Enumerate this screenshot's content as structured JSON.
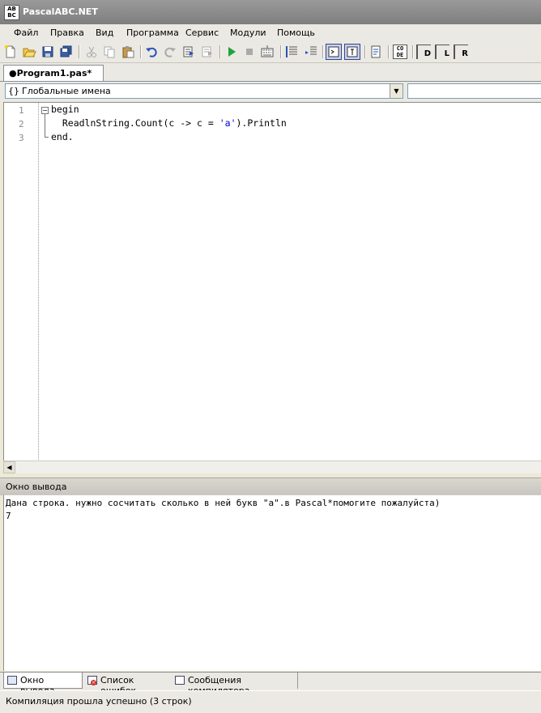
{
  "window": {
    "title": "PascalABC.NET",
    "icon_text": "AB\nBC"
  },
  "menu": [
    "Файл",
    "Правка",
    "Вид",
    "Программа",
    "Сервис",
    "Модули",
    "Помощь"
  ],
  "toolbar": {
    "icons": [
      "new-file-icon",
      "open-file-icon",
      "save-icon",
      "save-all-icon",
      "cut-icon",
      "copy-icon",
      "paste-icon",
      "undo-icon",
      "redo-icon",
      "step-into-icon",
      "step-over-icon",
      "run-icon",
      "stop-icon",
      "compile-icon",
      "comment-icon",
      "uncomment-icon",
      "console-view-icon",
      "text-view-icon",
      "format-icon",
      "code-icon",
      "sort-d-icon",
      "sort-l-icon",
      "sort-r-icon"
    ],
    "code_label": "CO\nDE",
    "d_label": "D",
    "l_label": "L",
    "r_label": "R"
  },
  "tabs": [
    {
      "label": "●Program1.pas*",
      "active": true
    }
  ],
  "scope": {
    "icon": "{}",
    "label": "Глобальные имена"
  },
  "editor": {
    "line_numbers": [
      "1",
      "2",
      "3"
    ],
    "lines": [
      {
        "text": "begin"
      },
      {
        "prefix": "  ReadlnString.Count(c -> c = ",
        "string": "'a'",
        "suffix": ").Println"
      },
      {
        "text": "end."
      }
    ]
  },
  "output_pane": {
    "title": "Окно вывода",
    "lines": [
      "Дана строка. нужно сосчитать сколько в ней букв \"а\".в Pascal*помогите пожалуйста)",
      "7"
    ]
  },
  "bottom_tabs": [
    {
      "label": "Окно вывода",
      "active": true
    },
    {
      "label": "Список ошибок"
    },
    {
      "label": "Сообщения компилятора"
    }
  ],
  "status": {
    "text": "Компиляция прошла успешно (3 строк)"
  },
  "colors": {
    "title_bar": "#8a8a8a",
    "string_literal": "#0000cc",
    "chrome": "#ebe9e3"
  }
}
